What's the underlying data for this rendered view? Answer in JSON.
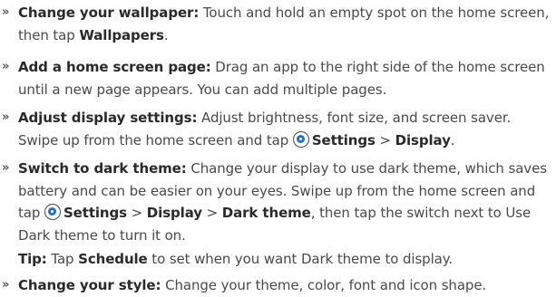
{
  "bullet_symbol": "»",
  "items": [
    {
      "lead": "Change your wallpaper:",
      "text1": " Touch and hold an empty spot on the home screen, then tap ",
      "b1": "Wallpapers",
      "text2": "."
    },
    {
      "lead": "Add a home screen page:",
      "text1": " Drag an app to the right side of the home screen until a new page appears. You can add multiple pages."
    },
    {
      "lead": "Adjust display settings:",
      "text1": " Adjust brightness, font size, and screen saver. Swipe up from the home screen and tap ",
      "icon": "settings-gear-icon",
      "b1": "Settings",
      "sep1": " > ",
      "b2": "Display",
      "text2": "."
    },
    {
      "lead": "Switch to dark theme:",
      "text1": " Change your display to use dark theme, which saves battery and can be easier on your eyes. Swipe up from the home screen and tap ",
      "icon": "settings-gear-icon",
      "b1": "Settings",
      "sep1": " > ",
      "b2": "Display",
      "sep2": " > ",
      "b3": "Dark theme",
      "text2": ", then tap the switch next to Use Dark theme to turn it on."
    },
    {
      "lead": "Change your style:",
      "text1": " Change your theme, color, font and icon shape."
    }
  ],
  "tip": {
    "label": "Tip:",
    "text1": " Tap ",
    "b1": "Schedule",
    "text2": " to set when you want Dark theme to display."
  }
}
